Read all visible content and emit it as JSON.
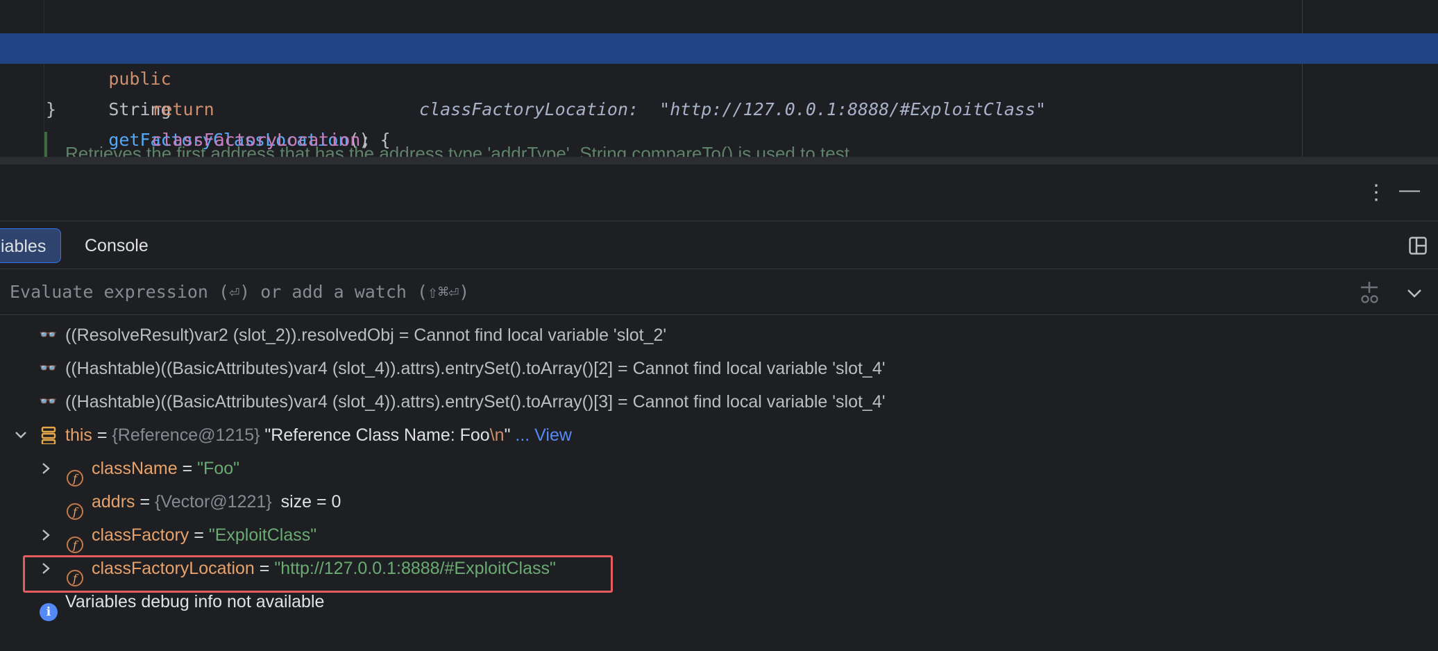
{
  "editor": {
    "line1": {
      "kw": "public",
      "type": "String",
      "method": "getFactoryClassLocation",
      "rest": "() {"
    },
    "line2": {
      "kw": "return",
      "field": "classFactoryLocation",
      "semi": ";",
      "hint": "classFactoryLocation:  \"http://127.0.0.1:8888/#ExploitClass\""
    },
    "line3": {
      "text": "}"
    },
    "doc_text": "Retrieves the first address that has the address type 'addrType'. String.compareTo() is used to test"
  },
  "debug": {
    "tabs": {
      "variables": "iables",
      "console": "Console"
    },
    "eval_placeholder": "Evaluate expression (⏎) or add a watch (⇧⌘⏎)"
  },
  "tree": {
    "watch1": "((ResolveResult)var2 (slot_2)).resolvedObj = Cannot find local variable 'slot_2'",
    "watch2": "((Hashtable)((BasicAttributes)var4 (slot_4)).attrs).entrySet().toArray()[2] = Cannot find local variable 'slot_4'",
    "watch3": "((Hashtable)((BasicAttributes)var4 (slot_4)).attrs).entrySet().toArray()[3] = Cannot find local variable 'slot_4'",
    "this_row": {
      "name": "this",
      "eq": "=",
      "ref": "{Reference@1215}",
      "value_a": "\"Reference Class Name: Foo",
      "value_esc": "\\n",
      "value_b": "\"",
      "view": "... View"
    },
    "fields": [
      {
        "name": "className",
        "eq": "=",
        "value": "\"Foo\""
      },
      {
        "name": "addrs",
        "eq": "=",
        "ref": "{Vector@1221}",
        "extra": "size = 0"
      },
      {
        "name": "classFactory",
        "eq": "=",
        "value": "\"ExploitClass\""
      },
      {
        "name": "classFactoryLocation",
        "eq": "=",
        "value": "\"http://127.0.0.1:8888/#ExploitClass\""
      }
    ],
    "info": "Variables debug info not available"
  },
  "colors": {
    "background": "#1e1f22",
    "execution_line": "#214283",
    "highlight_box": "#e55c5c",
    "string": "#6aab73",
    "field_name": "#e8a26a",
    "link": "#548af7"
  },
  "icons": [
    "more-vertical-icon",
    "minimize-icon",
    "layout-icon",
    "add-watch-icon",
    "chevron-down-icon",
    "watch-glasses-icon",
    "field-icon",
    "object-icon",
    "info-icon"
  ]
}
